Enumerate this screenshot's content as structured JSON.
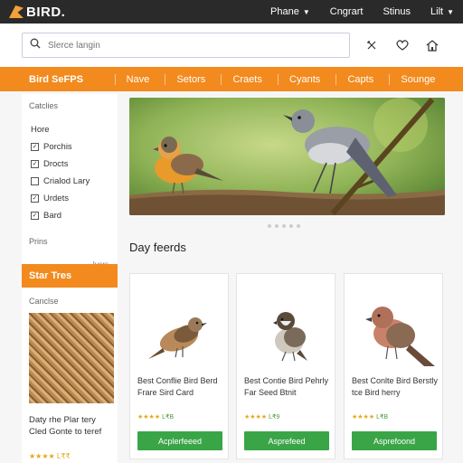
{
  "header": {
    "logo_text": "BIRD.",
    "nav": [
      "Phane",
      "Cngrart",
      "Stinus",
      "Lilt"
    ]
  },
  "search": {
    "placeholder": "Slerce langin"
  },
  "menubar": {
    "brand": "Bird SeFPS",
    "items": [
      "Nave",
      "Setors",
      "Craets",
      "Cyants",
      "Capts",
      "Sounge"
    ]
  },
  "sidebar": {
    "title": "Catclies",
    "items": [
      {
        "label": "Hore",
        "checkbox": false
      },
      {
        "label": "Porchis",
        "checkbox": true
      },
      {
        "label": "Drocts",
        "checkbox": true
      },
      {
        "label": "Crialod Lary",
        "checkbox": true
      },
      {
        "label": "Urdets",
        "checkbox": true
      },
      {
        "label": "Bard",
        "checkbox": true
      }
    ],
    "prins_label": "Prins",
    "small_label": "Ivers",
    "cta": "Star Tres",
    "promo_label": "Canclse",
    "promo_text": "Daty rhe Plar tery Cled Gonte to teref",
    "promo_stars": "★★★★ L₹₹"
  },
  "hero": {
    "dots": 5
  },
  "section": {
    "title": "Day feerds"
  },
  "products": [
    {
      "title": "Best Conflie Bird Berd Frare Sird Card",
      "stars": "★★★★",
      "price": "L₹B",
      "button": "Acplerfeeed"
    },
    {
      "title": "Best Contie Bird Pehrly Far Seed Btnit",
      "stars": "★★★★",
      "price": "L₹9",
      "button": "Asprefeed"
    },
    {
      "title": "Best Conlte Bird Berstly tce Bird herry",
      "stars": "★★★★",
      "price": "L₹B",
      "button": "Asprefoond"
    }
  ],
  "colors": {
    "accent": "#f28a1e",
    "button": "#3aa547",
    "topbar": "#2a2a2a"
  }
}
